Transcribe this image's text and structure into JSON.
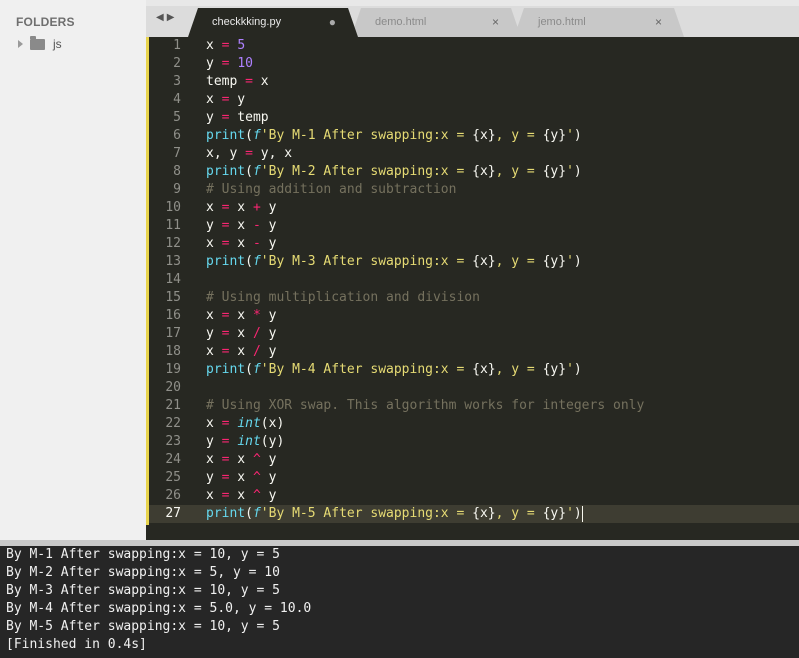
{
  "sidebar": {
    "title": "FOLDERS",
    "folders": [
      {
        "name": "js"
      }
    ]
  },
  "tabs": [
    {
      "label": "checkkking.py",
      "status": "●",
      "active": true
    },
    {
      "label": "demo.html",
      "status": "×",
      "active": false
    },
    {
      "label": "jemo.html",
      "status": "×",
      "active": false
    }
  ],
  "nav": {
    "back": "◀",
    "forward": "▶"
  },
  "editor": {
    "language": "python",
    "active_line": 27,
    "lines": [
      [
        [
          "x ",
          ""
        ],
        [
          "=",
          "op"
        ],
        [
          " ",
          ""
        ],
        [
          "5",
          "num"
        ]
      ],
      [
        [
          "y ",
          ""
        ],
        [
          "=",
          "op"
        ],
        [
          " ",
          ""
        ],
        [
          "10",
          "num"
        ]
      ],
      [
        [
          "temp ",
          ""
        ],
        [
          "=",
          "op"
        ],
        [
          " x",
          ""
        ]
      ],
      [
        [
          "x ",
          ""
        ],
        [
          "=",
          "op"
        ],
        [
          " y",
          ""
        ]
      ],
      [
        [
          "y ",
          ""
        ],
        [
          "=",
          "op"
        ],
        [
          " temp",
          ""
        ]
      ],
      [
        [
          "print",
          "fn"
        ],
        [
          "(",
          ""
        ],
        [
          "f",
          "fpref"
        ],
        [
          "'By M-1 After swapping:x = ",
          "str"
        ],
        [
          "{x}",
          ""
        ],
        [
          ", y = ",
          "str"
        ],
        [
          "{y}",
          ""
        ],
        [
          "'",
          "str"
        ],
        [
          ")",
          ""
        ]
      ],
      [
        [
          "x, y ",
          ""
        ],
        [
          "=",
          "op"
        ],
        [
          " y, x",
          ""
        ]
      ],
      [
        [
          "print",
          "fn"
        ],
        [
          "(",
          ""
        ],
        [
          "f",
          "fpref"
        ],
        [
          "'By M-2 After swapping:x = ",
          "str"
        ],
        [
          "{x}",
          ""
        ],
        [
          ", y = ",
          "str"
        ],
        [
          "{y}",
          ""
        ],
        [
          "'",
          "str"
        ],
        [
          ")",
          ""
        ]
      ],
      [
        [
          "# Using addition and subtraction",
          "cmt"
        ]
      ],
      [
        [
          "x ",
          ""
        ],
        [
          "=",
          "op"
        ],
        [
          " x ",
          ""
        ],
        [
          "+",
          "op"
        ],
        [
          " y",
          ""
        ]
      ],
      [
        [
          "y ",
          ""
        ],
        [
          "=",
          "op"
        ],
        [
          " x ",
          ""
        ],
        [
          "-",
          "op"
        ],
        [
          " y",
          ""
        ]
      ],
      [
        [
          "x ",
          ""
        ],
        [
          "=",
          "op"
        ],
        [
          " x ",
          ""
        ],
        [
          "-",
          "op"
        ],
        [
          " y",
          ""
        ]
      ],
      [
        [
          "print",
          "fn"
        ],
        [
          "(",
          ""
        ],
        [
          "f",
          "fpref"
        ],
        [
          "'By M-3 After swapping:x = ",
          "str"
        ],
        [
          "{x}",
          ""
        ],
        [
          ", y = ",
          "str"
        ],
        [
          "{y}",
          ""
        ],
        [
          "'",
          "str"
        ],
        [
          ")",
          ""
        ]
      ],
      [],
      [
        [
          "# Using multiplication and division",
          "cmt"
        ]
      ],
      [
        [
          "x ",
          ""
        ],
        [
          "=",
          "op"
        ],
        [
          " x ",
          ""
        ],
        [
          "*",
          "op"
        ],
        [
          " y",
          ""
        ]
      ],
      [
        [
          "y ",
          ""
        ],
        [
          "=",
          "op"
        ],
        [
          " x ",
          ""
        ],
        [
          "/",
          "op"
        ],
        [
          " y",
          ""
        ]
      ],
      [
        [
          "x ",
          ""
        ],
        [
          "=",
          "op"
        ],
        [
          " x ",
          ""
        ],
        [
          "/",
          "op"
        ],
        [
          " y",
          ""
        ]
      ],
      [
        [
          "print",
          "fn"
        ],
        [
          "(",
          ""
        ],
        [
          "f",
          "fpref"
        ],
        [
          "'By M-4 After swapping:x = ",
          "str"
        ],
        [
          "{x}",
          ""
        ],
        [
          ", y = ",
          "str"
        ],
        [
          "{y}",
          ""
        ],
        [
          "'",
          "str"
        ],
        [
          ")",
          ""
        ]
      ],
      [],
      [
        [
          "# Using XOR swap. This algorithm works for integers only",
          "cmt"
        ]
      ],
      [
        [
          "x ",
          ""
        ],
        [
          "=",
          "op"
        ],
        [
          " ",
          ""
        ],
        [
          "int",
          "builtin"
        ],
        [
          "(x)",
          ""
        ]
      ],
      [
        [
          "y ",
          ""
        ],
        [
          "=",
          "op"
        ],
        [
          " ",
          ""
        ],
        [
          "int",
          "builtin"
        ],
        [
          "(y)",
          ""
        ]
      ],
      [
        [
          "x ",
          ""
        ],
        [
          "=",
          "op"
        ],
        [
          " x ",
          ""
        ],
        [
          "^",
          "op"
        ],
        [
          " y",
          ""
        ]
      ],
      [
        [
          "y ",
          ""
        ],
        [
          "=",
          "op"
        ],
        [
          " x ",
          ""
        ],
        [
          "^",
          "op"
        ],
        [
          " y",
          ""
        ]
      ],
      [
        [
          "x ",
          ""
        ],
        [
          "=",
          "op"
        ],
        [
          " x ",
          ""
        ],
        [
          "^",
          "op"
        ],
        [
          " y",
          ""
        ]
      ],
      [
        [
          "print",
          "fn"
        ],
        [
          "(",
          ""
        ],
        [
          "f",
          "fpref"
        ],
        [
          "'By M-5 After swapping:x = ",
          "str"
        ],
        [
          "{x}",
          ""
        ],
        [
          ", y = ",
          "str"
        ],
        [
          "{y}",
          ""
        ],
        [
          "'",
          "str"
        ],
        [
          ")",
          ""
        ]
      ]
    ]
  },
  "console": {
    "lines": [
      "By M-1 After swapping:x = 10, y = 5",
      "By M-2 After swapping:x = 5, y = 10",
      "By M-3 After swapping:x = 10, y = 5",
      "By M-4 After swapping:x = 5.0, y = 10.0",
      "By M-5 After swapping:x = 10, y = 5",
      "[Finished in 0.4s]"
    ]
  },
  "colors": {
    "editor_bg": "#272822",
    "keyword": "#f92672",
    "number": "#ae81ff",
    "function": "#66d9ef",
    "string": "#e6db74",
    "comment": "#75715e",
    "console_bg": "#262626"
  }
}
